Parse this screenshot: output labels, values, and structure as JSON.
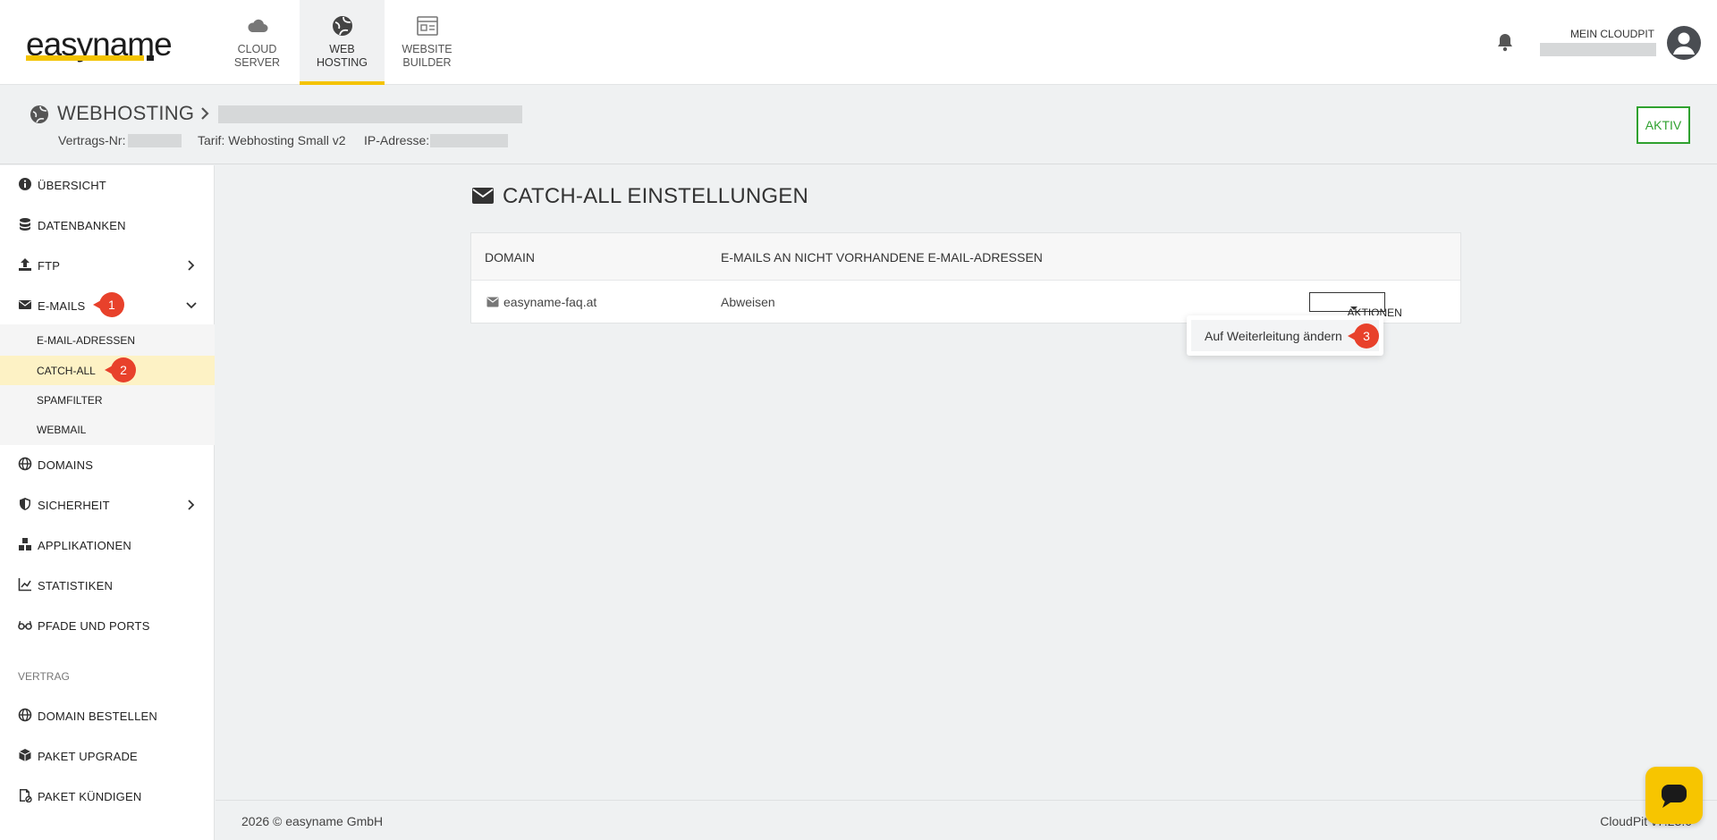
{
  "brand": {
    "logo_text": "easyname",
    "accent": "#f4c300"
  },
  "products": [
    {
      "line1": "CLOUD",
      "line2": "SERVER",
      "icon": "cloud-icon",
      "active": false
    },
    {
      "line1": "WEB",
      "line2": "HOSTING",
      "icon": "globe-icon",
      "active": true
    },
    {
      "line1": "WEBSITE",
      "line2": "BUILDER",
      "icon": "website-builder-icon",
      "active": false
    }
  ],
  "account": {
    "label": "MEIN CLOUDPIT"
  },
  "page_header": {
    "title": "WEBHOSTING",
    "contract_label": "Vertrags-Nr:",
    "tariff": "Tarif: Webhosting Small v2",
    "ip_label": "IP-Adresse:",
    "status": "AKTIV",
    "status_color": "#2fa12f"
  },
  "sidebar": {
    "items": [
      {
        "label": "ÜBERSICHT",
        "icon": "info-icon"
      },
      {
        "label": "DATENBANKEN",
        "icon": "database-icon"
      },
      {
        "label": "FTP",
        "icon": "upload-icon",
        "chevron": "right"
      },
      {
        "label": "E-MAILS",
        "icon": "envelope-icon",
        "chevron": "down",
        "marker": "1"
      }
    ],
    "email_sub": [
      {
        "label": "E-MAIL-ADRESSEN",
        "active": false
      },
      {
        "label": "CATCH-ALL",
        "active": true,
        "marker": "2"
      },
      {
        "label": "SPAMFILTER",
        "active": false
      },
      {
        "label": "WEBMAIL",
        "active": false
      }
    ],
    "items2": [
      {
        "label": "DOMAINS",
        "icon": "globe-icon"
      },
      {
        "label": "SICHERHEIT",
        "icon": "shield-icon",
        "chevron": "right"
      },
      {
        "label": "APPLIKATIONEN",
        "icon": "applications-icon"
      },
      {
        "label": "STATISTIKEN",
        "icon": "chart-line-icon"
      },
      {
        "label": "PFADE UND PORTS",
        "icon": "glasses-icon"
      }
    ],
    "section_label": "VERTRAG",
    "items3": [
      {
        "label": "DOMAIN BESTELLEN",
        "icon": "globe-icon"
      },
      {
        "label": "PAKET UPGRADE",
        "icon": "box-icon"
      },
      {
        "label": "PAKET KÜNDIGEN",
        "icon": "cancel-document-icon"
      }
    ]
  },
  "main": {
    "title": "CATCH-ALL EINSTELLUNGEN",
    "table": {
      "col_domain": "DOMAIN",
      "col_emails": "E-MAILS AN NICHT VORHANDENE E-MAIL-ADRESSEN",
      "row": {
        "domain": "easyname-faq.at",
        "action": "Abweisen",
        "button": "AKTIONEN"
      }
    },
    "dropdown": {
      "item": "Auf Weiterleitung ändern",
      "marker": "3"
    }
  },
  "footer": {
    "copyright": "2026 © easyname GmbH",
    "version": "CloudPit v7.23.0"
  }
}
